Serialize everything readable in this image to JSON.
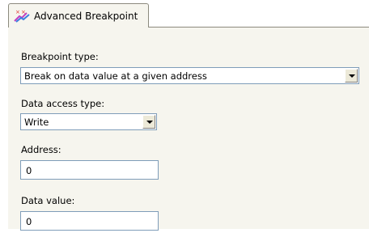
{
  "tab": {
    "label": "Advanced Breakpoint",
    "icon": "breakpoint-icon"
  },
  "breakpoint_type": {
    "label": "Breakpoint type:",
    "value": "Break on data value at a given address"
  },
  "data_access_type": {
    "label": "Data access type:",
    "value": "Write"
  },
  "address": {
    "label": "Address:",
    "value": "0"
  },
  "data_value": {
    "label": "Data value:",
    "value": "0"
  }
}
